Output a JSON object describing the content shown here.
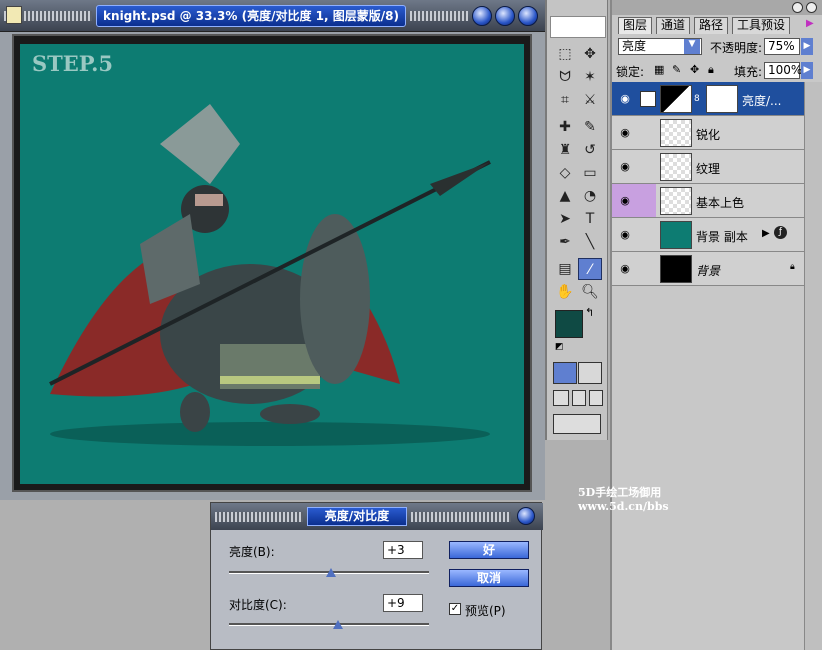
{
  "document": {
    "title": "knight.psd @ 33.3% (亮度/对比度 1, 图层蒙版/8)",
    "canvas_text": "STEP.5"
  },
  "layers_panel": {
    "tabs": [
      "图层",
      "通道",
      "路径",
      "工具预设"
    ],
    "blend_mode": "亮度",
    "opacity_label": "不透明度:",
    "opacity_value": "75%",
    "lock_label": "锁定:",
    "fill_label": "填充:",
    "fill_value": "100%",
    "layers": [
      {
        "name": "亮度/..."
      },
      {
        "name": "锐化"
      },
      {
        "name": "纹理"
      },
      {
        "name": "基本上色"
      },
      {
        "name": "背景 副本"
      },
      {
        "name": "背景"
      }
    ]
  },
  "dialog": {
    "title": "亮度/对比度",
    "brightness_label": "亮度(B):",
    "brightness_value": "+3",
    "contrast_label": "对比度(C):",
    "contrast_value": "+9",
    "ok_label": "好",
    "cancel_label": "取消",
    "preview_label": "预览(P)",
    "preview_checked": true,
    "brightness_slider_level": 0.51,
    "contrast_slider_level": 0.545
  },
  "watermark": {
    "line1": "5D手绘工场御用",
    "line2": "www.5d.cn/bbs"
  },
  "colors": {
    "foreground": "#0f4a44",
    "background": "#ffffff",
    "canvas_teal": "#0d7c72",
    "selection_blue": "#1f4f9e"
  }
}
